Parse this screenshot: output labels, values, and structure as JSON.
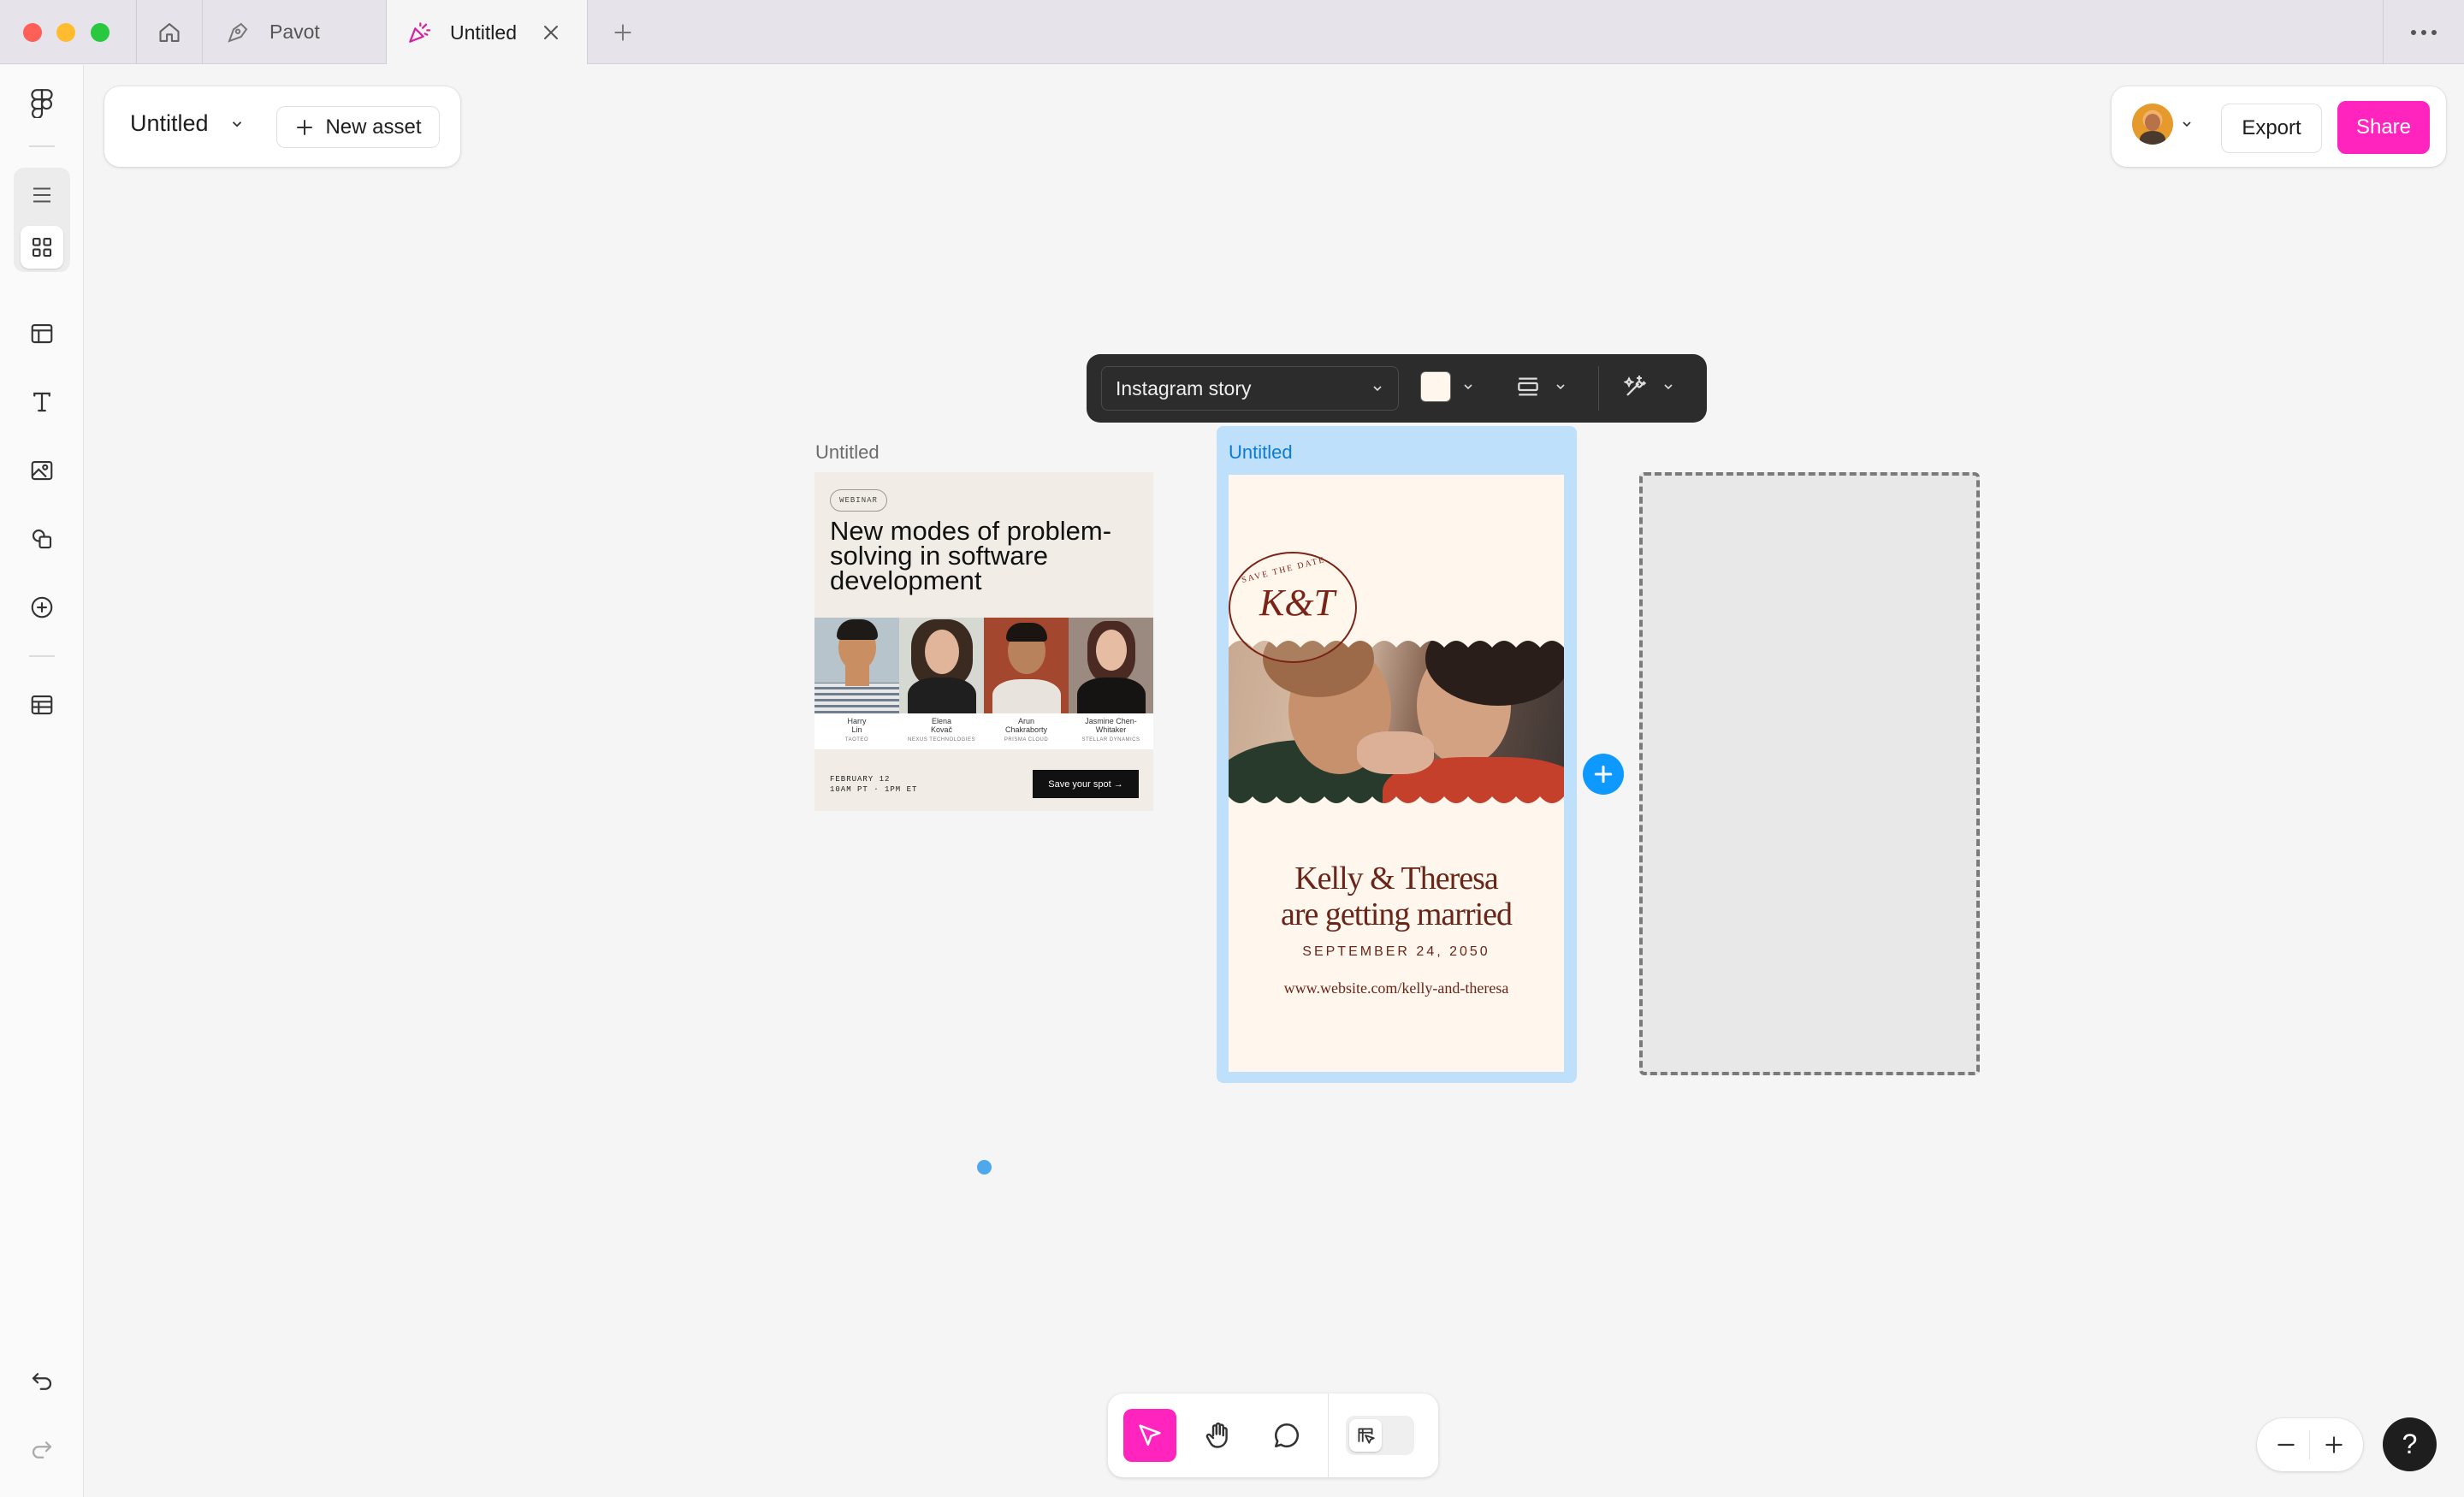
{
  "tabs": [
    {
      "label": "Pavot",
      "active": false
    },
    {
      "label": "Untitled",
      "active": true
    }
  ],
  "header": {
    "file_title": "Untitled",
    "new_asset_label": "New asset",
    "export_label": "Export",
    "share_label": "Share",
    "share_color": "#ff24bd"
  },
  "format_toolbar": {
    "format_value": "Instagram story",
    "fill_color": "#fff7ed"
  },
  "frames": [
    {
      "label": "Untitled",
      "selected": false
    },
    {
      "label": "Untitled",
      "selected": true
    }
  ],
  "webinar": {
    "badge": "WEBINAR",
    "title": "New modes of problem-solving in software development",
    "speakers": [
      {
        "name": "Harry Lin",
        "company": "TAOTEO"
      },
      {
        "name": "Elena Kovač",
        "company": "NEXUS TECHNOLOGIES"
      },
      {
        "name": "Arun Chakraborty",
        "company": "PRISMA CLOUD"
      },
      {
        "name": "Jasmine Chen-Whitaker",
        "company": "STELLAR DYNAMICS"
      }
    ],
    "date": "FEBRUARY 12",
    "time": "10AM PT · 1PM ET",
    "cta": "Save your spot →"
  },
  "wedding": {
    "stamp_text": "SAVE THE DATE",
    "monogram": "K&T",
    "headline_1": "Kelly & Theresa",
    "headline_2": "are getting married",
    "date": "SEPTEMBER 24, 2050",
    "url": "www.website.com/kelly-and-theresa"
  },
  "icons": {
    "home": "home-icon",
    "close_tab": "close-icon",
    "new_tab": "plus-icon",
    "more": "more-icon",
    "help": "question-mark-icon"
  },
  "help_label": "?"
}
